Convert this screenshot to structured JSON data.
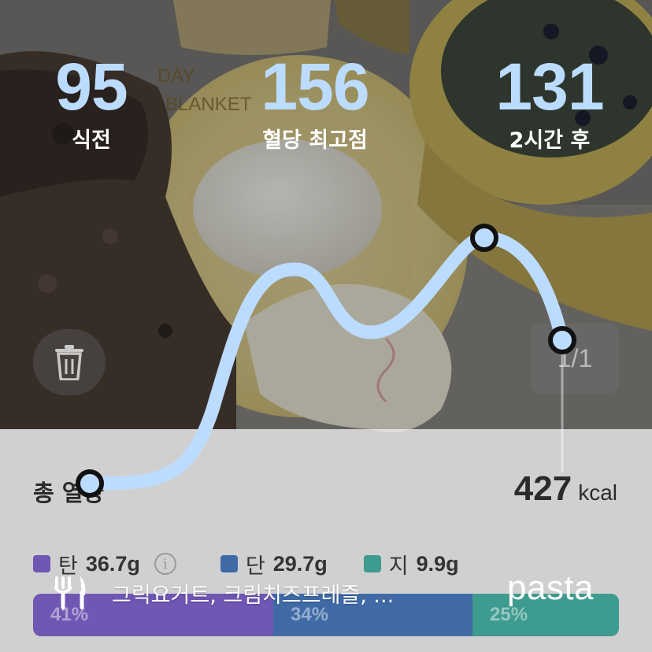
{
  "stats": {
    "before": {
      "value": "95",
      "label": "식전"
    },
    "peak": {
      "value": "156",
      "label": "혈당 최고점"
    },
    "after": {
      "value": "131",
      "label": "2시간 후"
    }
  },
  "pager": {
    "text": "1/1"
  },
  "summary": {
    "total_label": "총 열량",
    "calories": "427",
    "calorie_unit": "kcal"
  },
  "macros": [
    {
      "name": "탄",
      "amount": "36.7g",
      "color": "#7057b3",
      "percent": "41%",
      "share": 41
    },
    {
      "name": "단",
      "amount": "29.7g",
      "color": "#3f6aa6",
      "percent": "34%",
      "share": 34
    },
    {
      "name": "지",
      "amount": "9.9g",
      "color": "#3e9b8f",
      "percent": "25%",
      "share": 25
    }
  ],
  "food": {
    "names": "그릭요거트, 크림치즈프레즐, ..."
  },
  "brand": {
    "name": "pasta"
  },
  "colors": {
    "curve": "#bcdcff",
    "marker_outline": "#111111"
  },
  "icons": {
    "trash": "trash-icon",
    "fork_knife": "fork-knife-icon",
    "info": "info-icon"
  }
}
